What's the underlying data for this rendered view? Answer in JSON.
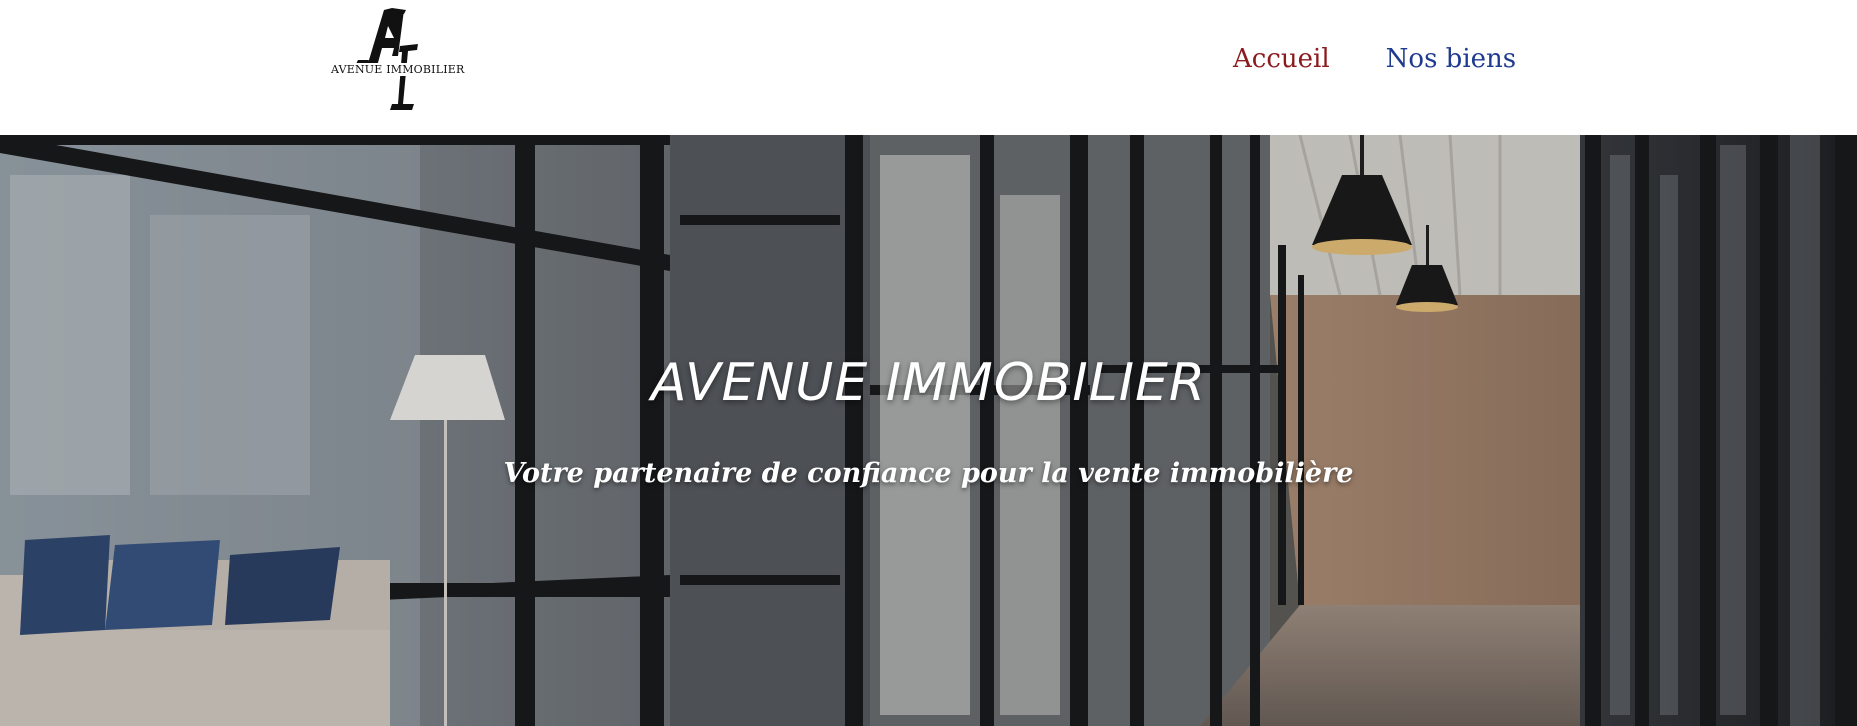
{
  "header": {
    "logo": {
      "monogram": "AI",
      "text": "AVENUE IMMOBILIER"
    },
    "nav": [
      {
        "label": "Accueil",
        "color": "#8b1b1f"
      },
      {
        "label": "Nos biens",
        "color": "#1f3b8f"
      }
    ]
  },
  "hero": {
    "title": "AVENUE IMMOBILIER",
    "subtitle": "Votre partenaire de confiance pour la vente immobilière"
  }
}
